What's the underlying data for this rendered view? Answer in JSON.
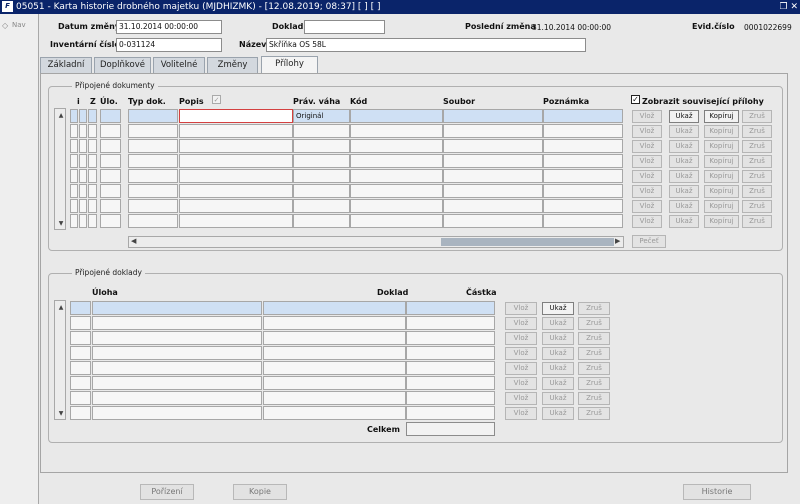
{
  "window": {
    "title": "05051 - Karta historie drobného majetku (MJDHIZMK) - [12.08.2019; 08:37]  [ ]  [ ]",
    "app_icon": "app-logo-icon"
  },
  "nav": {
    "label": "Nav"
  },
  "header": {
    "datum_zmeny_label": "Datum změny",
    "datum_zmeny_value": "31.10.2014 00:00:00",
    "doklad_label": "Doklad",
    "doklad_value": "",
    "posledni_zmena_label": "Poslední změna",
    "posledni_zmena_value": "31.10.2014 00:00:00",
    "evid_cislo_label": "Evid.číslo",
    "evid_cislo_value": "0001022699",
    "inventarni_label": "Inventární číslo",
    "inventarni_value": "0-031124",
    "nazev_label": "Název",
    "nazev_value": "Skříňka OS 58L"
  },
  "tabs": [
    "Základní",
    "Doplňkové",
    "Volitelné",
    "Změny",
    "Přílohy"
  ],
  "active_tab": "Přílohy",
  "dokumenty": {
    "group_label": "Připojené dokumenty",
    "columns": {
      "i": "i",
      "z": "Z",
      "ulo": "Úlo.",
      "typ": "Typ dok.",
      "popis": "Popis",
      "prav": "Práv. váha",
      "kod": "Kód",
      "soubor": "Soubor",
      "poznamka": "Poznámka"
    },
    "show_related_label": "Zobrazit související přílohy",
    "show_related_checked": true,
    "popis_checkbox_checked": true,
    "first_row_prav_vaha": "Originál",
    "row_count": 8,
    "buttons": {
      "vloz": "Vlož",
      "ukaz": "Ukaž",
      "kopiruj": "Kopíruj",
      "zrus": "Zruš"
    },
    "pecet": "Pečeť"
  },
  "doklady": {
    "group_label": "Připojené doklady",
    "columns": {
      "uloha": "Úloha",
      "doklad": "Doklad",
      "castka": "Částka"
    },
    "row_count": 8,
    "buttons": {
      "vloz": "Vlož",
      "ukaz": "Ukaž",
      "zrus": "Zruš"
    },
    "celkem_label": "Celkem",
    "celkem_value": ""
  },
  "footer": {
    "porizeni": "Pořízení",
    "kopie": "Kopie",
    "historie": "Historie"
  }
}
